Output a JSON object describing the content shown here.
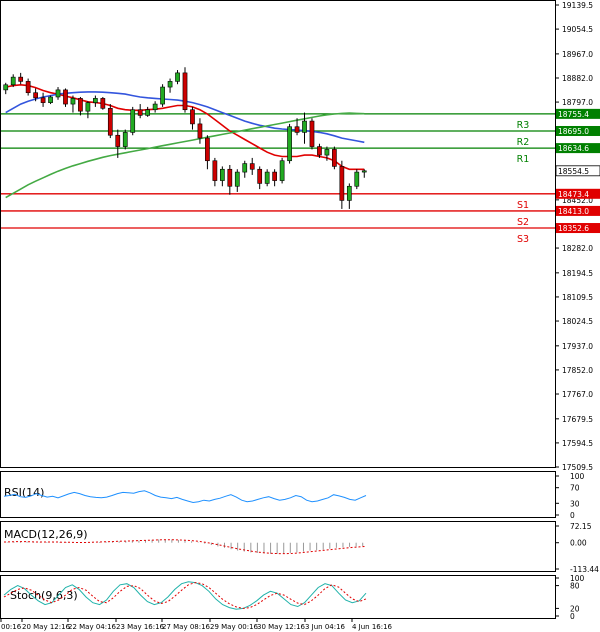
{
  "chart_data": [
    {
      "type": "candlestick",
      "panel": "price",
      "y_axis_ticks": [
        "19139.5",
        "19054.5",
        "18967.0",
        "18882.0",
        "18797.0",
        "18452.0",
        "18282.0",
        "18194.5",
        "18109.5",
        "18024.5",
        "17937.0",
        "17852.0",
        "17767.0",
        "17679.5",
        "17594.5",
        "17509.5"
      ],
      "ylim": [
        17509.5,
        19139.5
      ],
      "x_tick_labels": [
        "00:16",
        "20 May 12:16",
        "22 May 04:16",
        "23 May 16:16",
        "27 May 08:16",
        "29 May 00:16",
        "30 May 12:16",
        "3 Jun 04:16",
        "4 Jun 16:16"
      ],
      "levels": [
        {
          "name": "R3",
          "value": 18755.4,
          "label": "18755.4",
          "color": "#008000"
        },
        {
          "name": "R2",
          "value": 18695.0,
          "label": "18695.0",
          "color": "#008000"
        },
        {
          "name": "R1",
          "value": 18634.6,
          "label": "18634.6",
          "color": "#008000"
        },
        {
          "name": "S1",
          "value": 18473.4,
          "label": "18473.4",
          "color": "#e00000"
        },
        {
          "name": "S2",
          "value": 18413.0,
          "label": "18413.0",
          "color": "#e00000"
        },
        {
          "name": "S3",
          "value": 18352.6,
          "label": "18352.6",
          "color": "#e00000"
        }
      ],
      "current_price": {
        "value": 18554.5,
        "label": "18554.5"
      },
      "candles": [
        [
          18840,
          18865,
          18825,
          18858
        ],
        [
          18858,
          18895,
          18850,
          18885
        ],
        [
          18885,
          18900,
          18860,
          18870
        ],
        [
          18870,
          18880,
          18820,
          18830
        ],
        [
          18830,
          18845,
          18800,
          18812
        ],
        [
          18812,
          18830,
          18780,
          18795
        ],
        [
          18795,
          18820,
          18790,
          18815
        ],
        [
          18815,
          18850,
          18805,
          18840
        ],
        [
          18840,
          18845,
          18780,
          18790
        ],
        [
          18790,
          18820,
          18760,
          18810
        ],
        [
          18810,
          18815,
          18750,
          18765
        ],
        [
          18765,
          18800,
          18740,
          18795
        ],
        [
          18795,
          18820,
          18780,
          18810
        ],
        [
          18810,
          18815,
          18770,
          18775
        ],
        [
          18775,
          18790,
          18670,
          18680
        ],
        [
          18680,
          18700,
          18600,
          18640
        ],
        [
          18640,
          18700,
          18630,
          18690
        ],
        [
          18690,
          18780,
          18680,
          18770
        ],
        [
          18770,
          18790,
          18740,
          18750
        ],
        [
          18750,
          18780,
          18745,
          18770
        ],
        [
          18770,
          18800,
          18760,
          18790
        ],
        [
          18790,
          18860,
          18780,
          18850
        ],
        [
          18850,
          18880,
          18830,
          18870
        ],
        [
          18870,
          18910,
          18860,
          18900
        ],
        [
          18900,
          18920,
          18760,
          18770
        ],
        [
          18770,
          18780,
          18700,
          18720
        ],
        [
          18720,
          18740,
          18650,
          18670
        ],
        [
          18670,
          18680,
          18560,
          18590
        ],
        [
          18590,
          18600,
          18500,
          18520
        ],
        [
          18520,
          18570,
          18500,
          18560
        ],
        [
          18560,
          18575,
          18470,
          18500
        ],
        [
          18500,
          18560,
          18480,
          18550
        ],
        [
          18550,
          18590,
          18530,
          18580
        ],
        [
          18580,
          18600,
          18540,
          18560
        ],
        [
          18560,
          18570,
          18490,
          18510
        ],
        [
          18510,
          18560,
          18500,
          18550
        ],
        [
          18550,
          18560,
          18500,
          18520
        ],
        [
          18520,
          18600,
          18510,
          18590
        ],
        [
          18590,
          18720,
          18580,
          18710
        ],
        [
          18710,
          18740,
          18680,
          18690
        ],
        [
          18690,
          18760,
          18650,
          18730
        ],
        [
          18730,
          18740,
          18630,
          18640
        ],
        [
          18640,
          18650,
          18600,
          18610
        ],
        [
          18610,
          18640,
          18590,
          18630
        ],
        [
          18630,
          18640,
          18560,
          18570
        ],
        [
          18570,
          18590,
          18420,
          18450
        ],
        [
          18450,
          18510,
          18420,
          18500
        ],
        [
          18500,
          18560,
          18490,
          18550
        ],
        [
          18550,
          18560,
          18530,
          18554.5
        ]
      ],
      "moving_averages": [
        {
          "color": "#e00000",
          "values": [
            18850,
            18855,
            18858,
            18855,
            18848,
            18838,
            18830,
            18825,
            18818,
            18812,
            18805,
            18798,
            18795,
            18792,
            18785,
            18775,
            18770,
            18768,
            18768,
            18770,
            18772,
            18775,
            18780,
            18785,
            18785,
            18780,
            18770,
            18755,
            18735,
            18715,
            18695,
            18680,
            18665,
            18650,
            18635,
            18620,
            18610,
            18605,
            18605,
            18605,
            18610,
            18610,
            18605,
            18600,
            18590,
            18570,
            18560,
            18560,
            18560
          ]
        },
        {
          "color": "#3355dd",
          "values": [
            18760,
            18775,
            18790,
            18800,
            18808,
            18815,
            18820,
            18825,
            18828,
            18830,
            18832,
            18833,
            18833,
            18832,
            18830,
            18828,
            18825,
            18820,
            18815,
            18812,
            18810,
            18808,
            18806,
            18804,
            18800,
            18795,
            18788,
            18780,
            18770,
            18760,
            18750,
            18740,
            18730,
            18722,
            18715,
            18710,
            18705,
            18702,
            18700,
            18698,
            18696,
            18694,
            18690,
            18685,
            18678,
            18670,
            18665,
            18660,
            18655
          ]
        },
        {
          "color": "#44aa44",
          "values": [
            18460,
            18475,
            18490,
            18505,
            18518,
            18530,
            18542,
            18553,
            18563,
            18572,
            18580,
            18588,
            18595,
            18602,
            18608,
            18613,
            18618,
            18623,
            18628,
            18633,
            18638,
            18643,
            18648,
            18653,
            18658,
            18663,
            18668,
            18673,
            18678,
            18683,
            18688,
            18693,
            18698,
            18703,
            18708,
            18713,
            18718,
            18723,
            18728,
            18733,
            18738,
            18743,
            18748,
            18752,
            18755,
            18757,
            18758,
            18757,
            18756
          ]
        }
      ]
    },
    {
      "type": "line",
      "panel": "rsi",
      "title": "RSI(14)",
      "y_axis_ticks": [
        "100",
        "70",
        "30",
        "0"
      ],
      "ylim": [
        0,
        100
      ],
      "values": [
        48,
        50,
        53,
        47,
        45,
        49,
        55,
        50,
        46,
        48,
        44,
        49,
        54,
        58,
        55,
        50,
        47,
        45,
        44,
        46,
        50,
        55,
        58,
        57,
        56,
        60,
        62,
        57,
        50,
        46,
        44,
        42,
        45,
        40,
        36,
        32,
        34,
        38,
        36,
        40,
        43,
        48,
        52,
        46,
        38,
        34,
        36,
        40,
        44,
        47,
        42,
        38,
        40,
        44,
        50,
        47,
        38,
        34,
        36,
        40,
        44,
        52,
        49,
        45,
        40,
        38,
        44,
        50
      ]
    },
    {
      "type": "bar",
      "panel": "macd",
      "title": "MACD(12,26,9)",
      "y_axis_ticks": [
        "72.15",
        "0.00",
        "-113.44"
      ],
      "ylim": [
        -113.44,
        72.15
      ],
      "histogram": [
        2,
        4,
        6,
        5,
        3,
        2,
        3,
        4,
        3,
        2,
        1,
        0,
        1,
        2,
        3,
        4,
        5,
        6,
        7,
        8,
        9,
        10,
        12,
        14,
        15,
        14,
        12,
        10,
        6,
        2,
        -4,
        -10,
        -16,
        -22,
        -28,
        -34,
        -38,
        -42,
        -44,
        -46,
        -48,
        -48,
        -46,
        -44,
        -42,
        -38,
        -34,
        -32,
        -30,
        -26,
        -22,
        -20,
        -18,
        -16,
        -14
      ],
      "signal": [
        3,
        4,
        5,
        5,
        4,
        3,
        3,
        3,
        3,
        2,
        2,
        1,
        1,
        2,
        3,
        4,
        5,
        6,
        7,
        8,
        9,
        10,
        11,
        12,
        13,
        13,
        12,
        11,
        9,
        6,
        2,
        -3,
        -9,
        -15,
        -21,
        -27,
        -32,
        -37,
        -41,
        -44,
        -46,
        -47,
        -47,
        -46,
        -44,
        -41,
        -38,
        -35,
        -32,
        -29,
        -26,
        -23,
        -20,
        -18,
        -16
      ]
    },
    {
      "type": "line",
      "panel": "stochastic",
      "title": "Stoch(9,6,3)",
      "y_axis_ticks": [
        "100",
        "80",
        "20",
        "0"
      ],
      "ylim": [
        0,
        100
      ],
      "k_values": [
        55,
        70,
        80,
        72,
        55,
        40,
        30,
        35,
        55,
        75,
        82,
        70,
        50,
        35,
        30,
        42,
        65,
        82,
        85,
        75,
        55,
        38,
        30,
        35,
        50,
        70,
        85,
        90,
        88,
        80,
        65,
        45,
        30,
        22,
        18,
        20,
        28,
        40,
        55,
        65,
        60,
        45,
        30,
        25,
        35,
        55,
        75,
        85,
        80,
        60,
        42,
        35,
        40,
        60
      ],
      "d_values": [
        50,
        60,
        70,
        74,
        68,
        55,
        42,
        35,
        42,
        55,
        70,
        75,
        68,
        52,
        38,
        35,
        48,
        65,
        78,
        80,
        72,
        55,
        40,
        33,
        38,
        52,
        68,
        82,
        88,
        85,
        75,
        60,
        44,
        32,
        24,
        20,
        22,
        30,
        42,
        54,
        60,
        55,
        44,
        34,
        30,
        40,
        55,
        72,
        82,
        76,
        60,
        45,
        38,
        45
      ]
    }
  ]
}
